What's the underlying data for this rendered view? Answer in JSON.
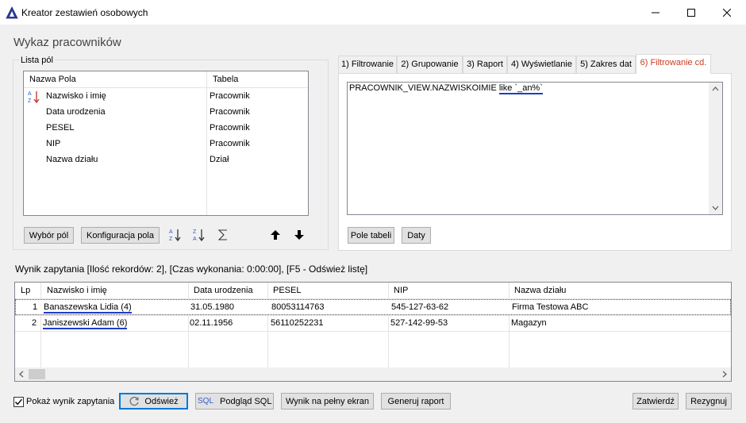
{
  "window": {
    "title": "Kreator zestawień osobowych"
  },
  "page": {
    "title": "Wykaz pracowników"
  },
  "field_list": {
    "group_label": "Lista pól",
    "col_name": "Nazwa Pola",
    "col_table": "Tabela",
    "rows": [
      {
        "name": "Nazwisko i imię",
        "table": "Pracownik"
      },
      {
        "name": "Data urodzenia",
        "table": "Pracownik"
      },
      {
        "name": "PESEL",
        "table": "Pracownik"
      },
      {
        "name": "NIP",
        "table": "Pracownik"
      },
      {
        "name": "Nazwa działu",
        "table": "Dział"
      }
    ],
    "btn_select": "Wybór pól",
    "btn_config": "Konfiguracja pola"
  },
  "tabs": [
    {
      "label": "1) Filtrowanie"
    },
    {
      "label": "2) Grupowanie"
    },
    {
      "label": "3) Raport"
    },
    {
      "label": "4) Wyświetlanie"
    },
    {
      "label": "5) Zakres dat"
    },
    {
      "label": "6) Filtrowanie cd."
    }
  ],
  "filter": {
    "sql_prefix": "PRACOWNIK_VIEW.NAZWISKOIMIE",
    "sql_suffix": "like `_an%`",
    "btn_fields": "Pole tabeli",
    "btn_dates": "Daty"
  },
  "result": {
    "info": "Wynik zapytania [Ilość rekordów: 2], [Czas wykonania:  0:00:00], [F5 - Odśwież listę]",
    "columns": [
      "Lp",
      "Nazwisko i imię",
      "Data urodzenia",
      "PESEL",
      "NIP",
      "Nazwa działu"
    ],
    "rows": [
      [
        "1",
        "Banaszewska Lidia (4)",
        "31.05.1980",
        "80053114763",
        "545-127-63-62",
        "Firma Testowa ABC"
      ],
      [
        "2",
        "Janiszewski Adam (6)",
        "02.11.1956",
        "56110252231",
        "527-142-99-53",
        "Magazyn"
      ]
    ]
  },
  "footer": {
    "show_result_label": "Pokaż wynik zapytania",
    "show_result_checked": true,
    "btn_refresh": "Odśwież",
    "btn_sql": "Podgląd SQL",
    "sql_badge": "SQL",
    "btn_fullscreen": "Wynik na pełny ekran",
    "btn_report": "Generuj raport",
    "btn_confirm": "Zatwierdź",
    "btn_cancel": "Rezygnuj"
  },
  "colors": {
    "active_tab": "#cc3c1f",
    "focus_border": "#0078d7",
    "spell_underline": "#1c3fc7"
  }
}
